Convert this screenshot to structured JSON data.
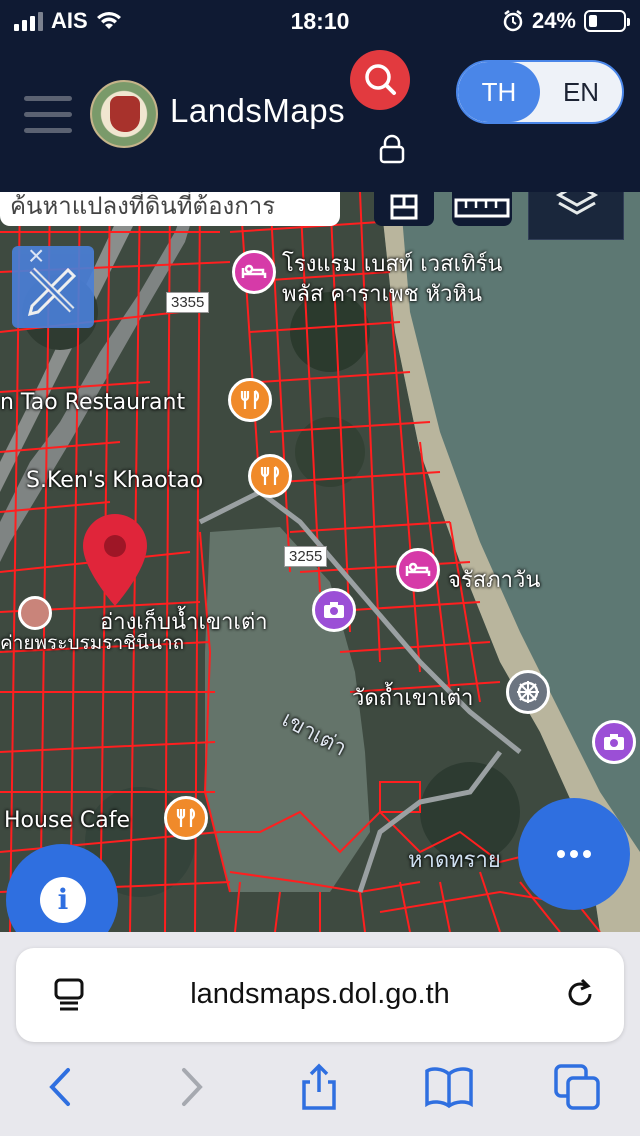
{
  "status_bar": {
    "carrier": "AIS",
    "time": "18:10",
    "battery_percent": "24%",
    "battery_level": 0.24,
    "icons": [
      "signal-icon",
      "wifi-icon",
      "alarm-icon",
      "battery-icon"
    ]
  },
  "header": {
    "brand": "LandsMaps",
    "lang": {
      "active": "TH",
      "inactive": "EN"
    },
    "colors": {
      "bar": "#0f1a33",
      "search": "#e23a3f",
      "accent": "#4a86e8"
    }
  },
  "map": {
    "search_placeholder": "ค้นหาแปลงที่ดินที่ต้องการ",
    "labels": {
      "hotel_name_line1": "โรงแรม เบสท์ เวสเทิร์น",
      "hotel_name_line2": "พลัส คาราเพช หัวหิน",
      "route_3355": "3355",
      "route_3255": "3255",
      "restaurant": "n Tao Restaurant",
      "khaotao": "S.Ken's Khaotao",
      "jarasphawan": "จรัสภาวัน",
      "reservoir": "อ่างเก็บน้ำเขาเต่า",
      "project": "ค่ายพระบรมราชินีนาถ",
      "temple": "วัดถ้ำเขาเต่า",
      "khao_tao": "เขาเต่า",
      "house_cafe": "House Cafe",
      "beach": "หาดทราย"
    }
  },
  "browser": {
    "url": "landsmaps.dol.go.th"
  }
}
